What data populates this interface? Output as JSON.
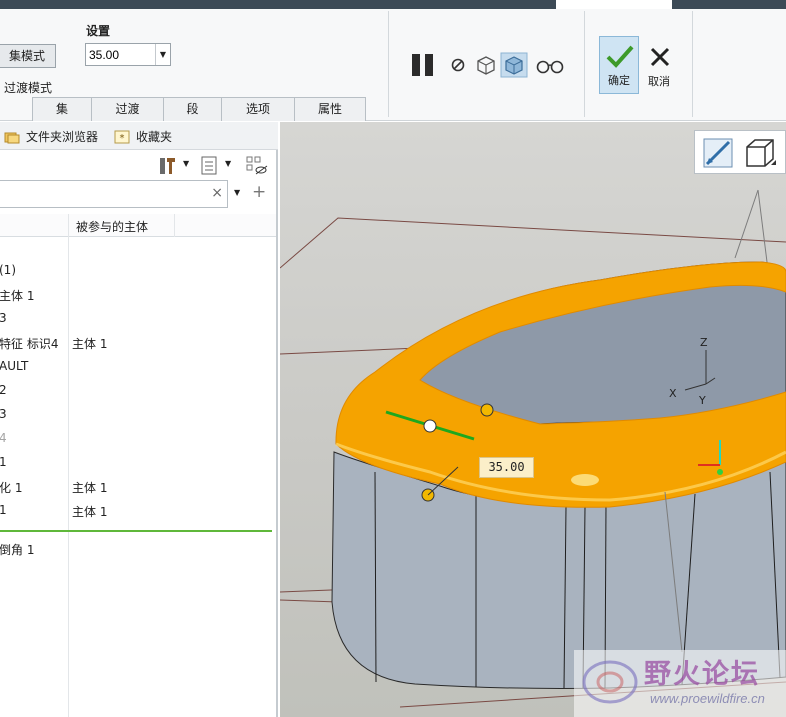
{
  "ribbon": {
    "settings_label": "设置",
    "set_mode_button": "集模式",
    "transition_mode": "过渡模式",
    "radius_value": "35.00",
    "tabs": [
      "集",
      "过渡",
      "段",
      "选项",
      "属性"
    ],
    "confirm_label": "确定",
    "cancel_label": "取消"
  },
  "nav_tabs": {
    "folder_browser": "文件夹浏览器",
    "favorites": "收藏夹"
  },
  "tree": {
    "col_participating_body": "被参与的主体",
    "rows": [
      {
        "name": "(1)",
        "body": ""
      },
      {
        "name": "主体 1",
        "body": ""
      },
      {
        "name": "3",
        "body": ""
      },
      {
        "name": "特征 标识4",
        "body": "主体 1"
      },
      {
        "name": "AULT",
        "body": ""
      },
      {
        "name": "2",
        "body": ""
      },
      {
        "name": "3",
        "body": ""
      },
      {
        "name": "4",
        "body": ""
      },
      {
        "name": "1",
        "body": ""
      },
      {
        "name": "化 1",
        "body": "主体 1"
      },
      {
        "name": "1",
        "body": "主体 1"
      },
      {
        "name": "倒角 1",
        "body": ""
      }
    ]
  },
  "viewport": {
    "dimension_value": "35.00",
    "axis_x": "X",
    "axis_y": "Y",
    "axis_z": "Z"
  },
  "watermark": {
    "title": "野火论坛",
    "url": "www.proewildfire.cn"
  },
  "colors": {
    "fillet_orange": "#f5a300",
    "body_gray": "#a7b1bd",
    "confirm_bg": "#cfe4f3",
    "accent_green": "#5fb83a"
  }
}
